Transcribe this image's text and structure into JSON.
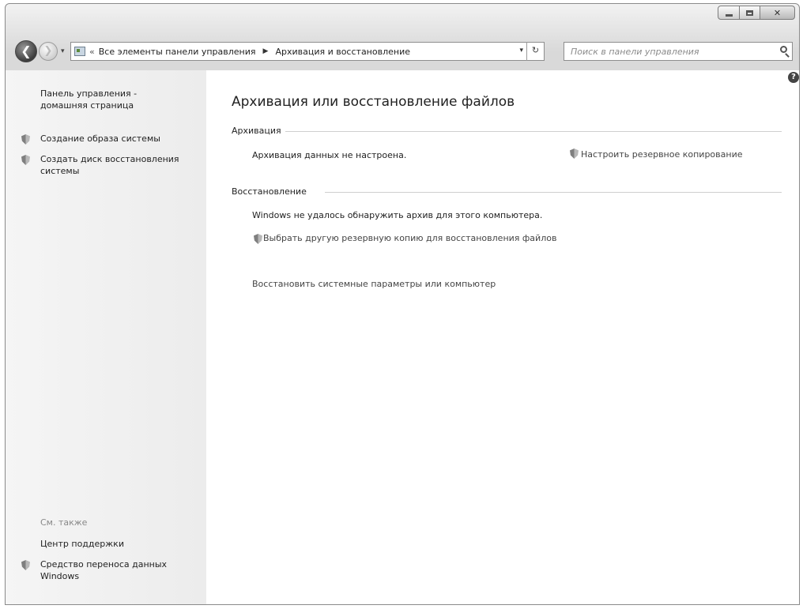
{
  "window": {
    "caption": {
      "min_glyph": "",
      "close_glyph": "✕"
    }
  },
  "nav": {
    "back_glyph": "❮",
    "forward_glyph": "❯",
    "history_glyph": "▾",
    "address": {
      "chevron": "«",
      "segments": [
        "Все элементы панели управления",
        "Архивация и восстановление"
      ],
      "separator": "▶",
      "dropdown_glyph": "▾",
      "refresh_glyph": "↻"
    },
    "search": {
      "placeholder": "Поиск в панели управления"
    }
  },
  "sidebar": {
    "home_link": "Панель управления -\nдомашняя страница",
    "items": [
      {
        "label": "Создание образа системы",
        "icon": "shield-icon"
      },
      {
        "label": "Создать диск восстановления\nсистемы",
        "icon": "shield-icon"
      }
    ],
    "see_also": {
      "heading": "См. также",
      "items": [
        {
          "label": "Центр поддержки"
        },
        {
          "label": "Средство переноса данных\nWindows",
          "icon": "shield-icon"
        }
      ]
    }
  },
  "main": {
    "title": "Архивация или восстановление файлов",
    "backup": {
      "heading": "Архивация",
      "status": "Архивация данных не настроена.",
      "setup_link": "Настроить резервное копирование"
    },
    "restore": {
      "heading": "Восстановление",
      "status": "Windows не удалось обнаружить архив для этого компьютера.",
      "select_backup_link": "Выбрать другую резервную копию для восстановления файлов",
      "recover_link": "Восстановить системные параметры или компьютер"
    },
    "help_glyph": "?"
  }
}
